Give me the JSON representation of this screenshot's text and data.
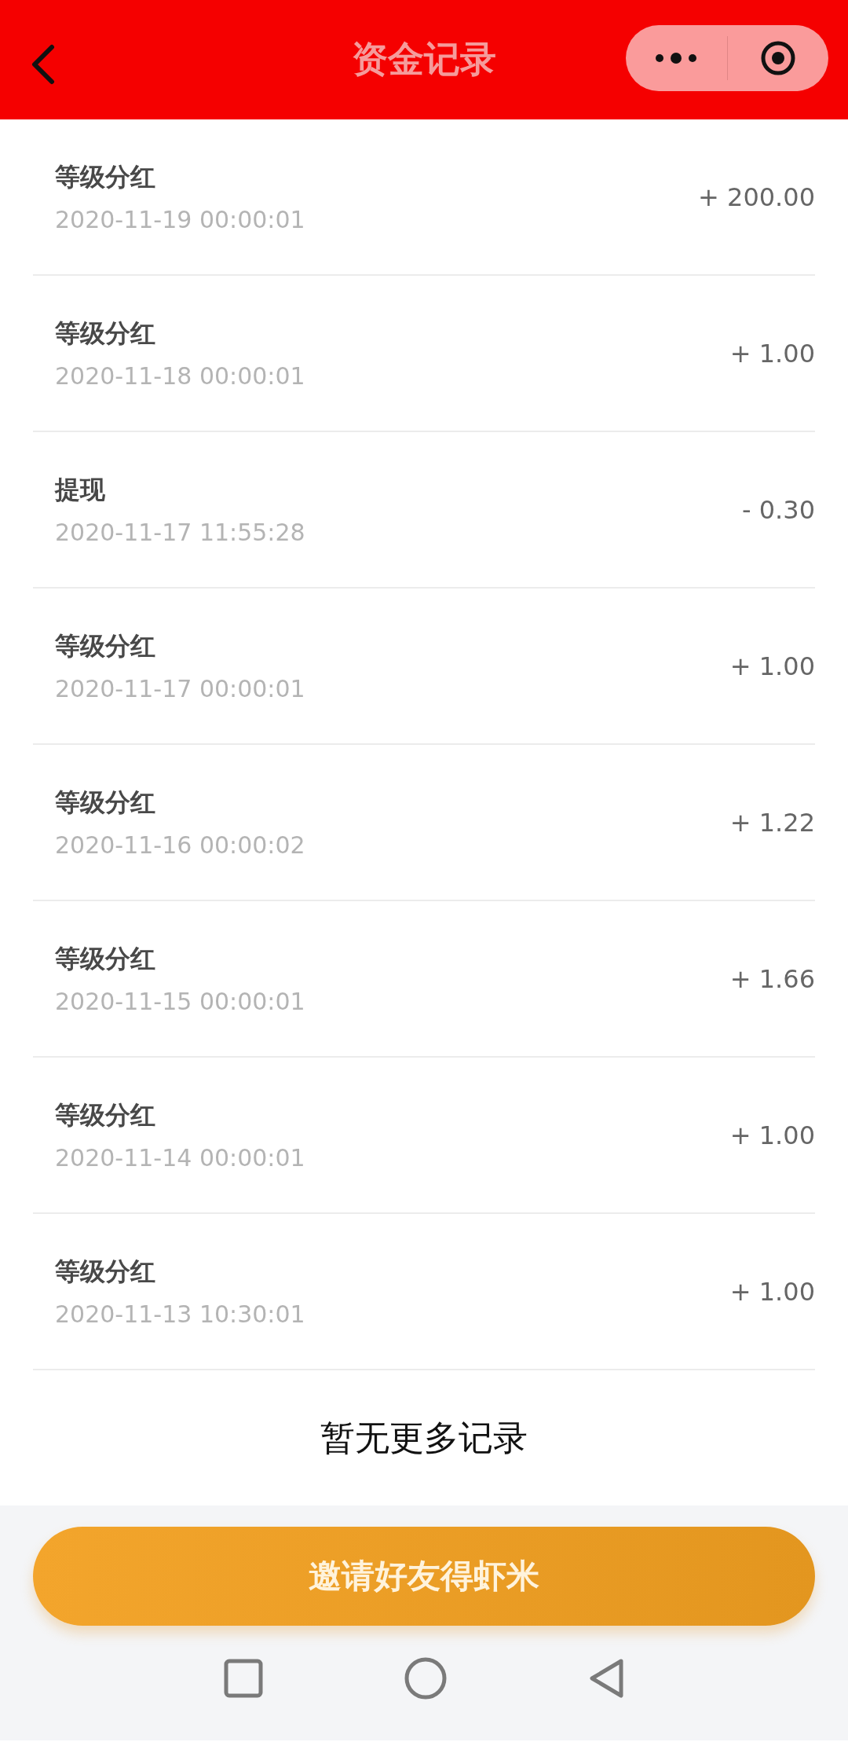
{
  "header": {
    "title": "资金记录"
  },
  "records": [
    {
      "title": "等级分红",
      "time": "2020-11-19 00:00:01",
      "amount": "+ 200.00"
    },
    {
      "title": "等级分红",
      "time": "2020-11-18 00:00:01",
      "amount": "+ 1.00"
    },
    {
      "title": "提现",
      "time": "2020-11-17 11:55:28",
      "amount": "- 0.30"
    },
    {
      "title": "等级分红",
      "time": "2020-11-17 00:00:01",
      "amount": "+ 1.00"
    },
    {
      "title": "等级分红",
      "time": "2020-11-16 00:00:02",
      "amount": "+ 1.22"
    },
    {
      "title": "等级分红",
      "time": "2020-11-15 00:00:01",
      "amount": "+ 1.66"
    },
    {
      "title": "等级分红",
      "time": "2020-11-14 00:00:01",
      "amount": "+ 1.00"
    },
    {
      "title": "等级分红",
      "time": "2020-11-13 10:30:01",
      "amount": "+ 1.00"
    }
  ],
  "end_note": "暂无更多记录",
  "invite_button": "邀请好友得虾米"
}
